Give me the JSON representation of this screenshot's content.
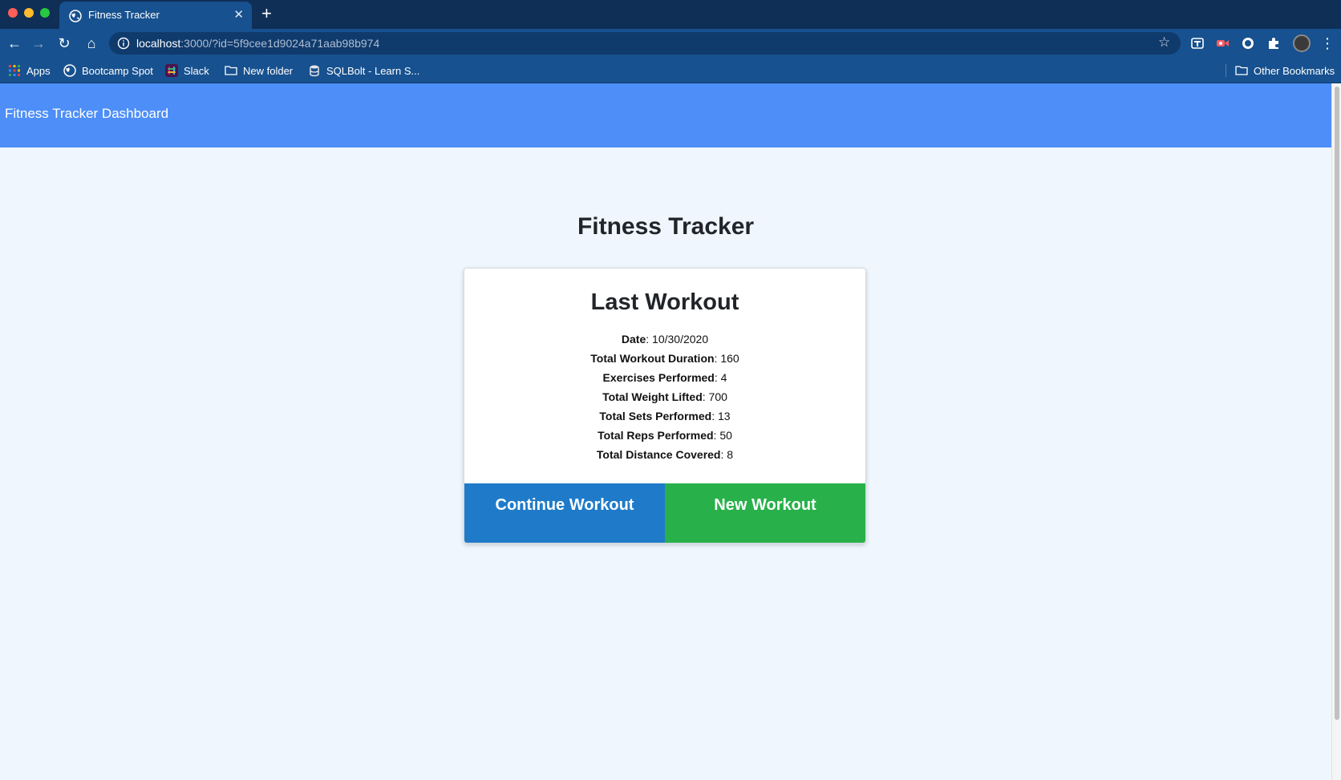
{
  "browser": {
    "tab_title": "Fitness Tracker",
    "tab_close": "✕",
    "new_tab": "+",
    "url_host": "localhost",
    "url_rest": ":3000/?id=5f9cee1d9024a71aab98b974",
    "nav": {
      "back": "←",
      "forward": "→",
      "reload": "↻",
      "home": "⌂",
      "star": "☆",
      "menu": "⋮"
    },
    "bookmarks": {
      "apps": "Apps",
      "bootcamp": "Bootcamp Spot",
      "slack": "Slack",
      "new_folder": "New folder",
      "sqlbolt": "SQLBolt - Learn S...",
      "other": "Other Bookmarks"
    }
  },
  "app": {
    "brand": "Fitness Tracker Dashboard",
    "page_title": "Fitness Tracker",
    "card_title": "Last Workout",
    "stats": [
      {
        "label": "Date",
        "value": "10/30/2020"
      },
      {
        "label": "Total Workout Duration",
        "value": "160"
      },
      {
        "label": "Exercises Performed",
        "value": "4"
      },
      {
        "label": "Total Weight Lifted",
        "value": "700"
      },
      {
        "label": "Total Sets Performed",
        "value": "13"
      },
      {
        "label": "Total Reps Performed",
        "value": "50"
      },
      {
        "label": "Total Distance Covered",
        "value": "8"
      }
    ],
    "continue_label": "Continue Workout",
    "new_label": "New Workout"
  },
  "colors": {
    "navbar": "#4d8ef8",
    "page_bg": "#eff6fe",
    "continue_button": "#1f7bc9",
    "new_button": "#28b14a",
    "browser_frame": "#17518f"
  },
  "icons": {
    "tab": "globe-icon",
    "omnibox": "info-icon",
    "extensions": [
      "translate-icon",
      "screen-record-icon",
      "circle-extension-icon",
      "puzzle-icon"
    ]
  }
}
